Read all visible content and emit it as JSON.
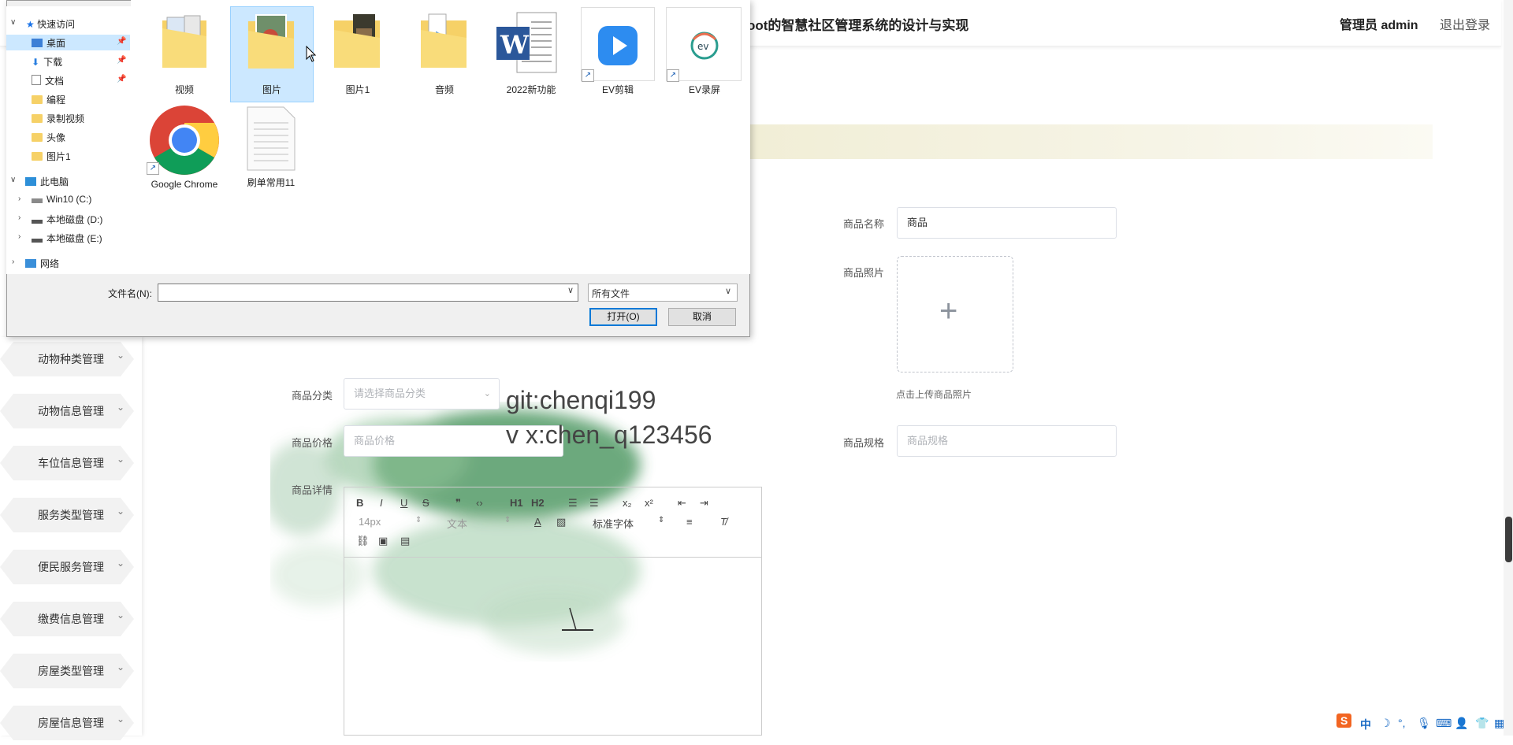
{
  "header": {
    "title": "oot的智慧社区管理系统的设计与实现",
    "admin": "管理员 admin",
    "logout": "退出登录"
  },
  "sidebar": {
    "items": [
      {
        "label": "动物种类管理"
      },
      {
        "label": "动物信息管理"
      },
      {
        "label": "车位信息管理"
      },
      {
        "label": "服务类型管理"
      },
      {
        "label": "便民服务管理"
      },
      {
        "label": "缴费信息管理"
      },
      {
        "label": "房屋类型管理"
      },
      {
        "label": "房屋信息管理"
      }
    ]
  },
  "form": {
    "name_label": "商品名称",
    "name_value": "商品",
    "photo_label": "商品照片",
    "photo_hint": "点击上传商品照片",
    "category_label": "商品分类",
    "category_placeholder": "请选择商品分类",
    "price_label": "商品价格",
    "price_placeholder": "商品价格",
    "spec_label": "商品规格",
    "spec_placeholder": "商品规格",
    "detail_label": "商品详情"
  },
  "editor": {
    "h1": "H1",
    "h2": "H2",
    "sub": "x₂",
    "sup": "x²",
    "font_size": "14px",
    "text_style": "文本",
    "font_family": "标准字体"
  },
  "watermark": {
    "line1": "git:chenqi199",
    "line2": "v x:chen_q123456"
  },
  "dialog": {
    "nav": {
      "quick_access": "快速访问",
      "items": [
        {
          "label": "桌面",
          "pinned": true
        },
        {
          "label": "下载",
          "pinned": true
        },
        {
          "label": "文档",
          "pinned": true
        },
        {
          "label": "编程"
        },
        {
          "label": "录制视频"
        },
        {
          "label": "头像"
        },
        {
          "label": "图片1"
        }
      ],
      "this_pc": "此电脑",
      "drives": [
        {
          "label": "Win10 (C:)"
        },
        {
          "label": "本地磁盘 (D:)"
        },
        {
          "label": "本地磁盘 (E:)"
        }
      ],
      "network": "网络"
    },
    "files": [
      {
        "label": "视频",
        "icon": "folder-video-icon"
      },
      {
        "label": "图片",
        "icon": "folder-pictures-icon",
        "selected": true
      },
      {
        "label": "图片1",
        "icon": "folder-photo-icon"
      },
      {
        "label": "音频",
        "icon": "folder-music-icon"
      },
      {
        "label": "2022新功能",
        "icon": "word-document-icon"
      },
      {
        "label": "EV剪辑",
        "icon": "ev-editor-shortcut-icon"
      },
      {
        "label": "EV录屏",
        "icon": "ev-recorder-shortcut-icon"
      },
      {
        "label": "Google Chrome",
        "icon": "chrome-shortcut-icon"
      },
      {
        "label": "刷单常用11",
        "icon": "text-file-icon"
      }
    ],
    "filename_label": "文件名(N):",
    "filename_value": "",
    "filetype": "所有文件",
    "open_button": "打开(O)",
    "cancel_button": "取消"
  },
  "colors": {
    "accent": "#0078d7",
    "selection": "#cce8ff"
  }
}
